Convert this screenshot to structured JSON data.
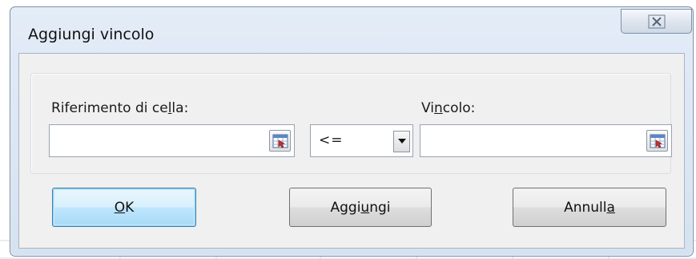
{
  "dialog": {
    "title": "Aggiungi vincolo",
    "close_glyph": "☒"
  },
  "fields": {
    "cell_reference": {
      "label_pre": "Riferimento di ce",
      "label_mnemonic": "l",
      "label_post": "la:",
      "value": "",
      "button_icon": "collapse-dialog-icon"
    },
    "operator": {
      "selected": "<=",
      "arrow_icon": "dropdown-arrow-icon"
    },
    "constraint": {
      "label_pre": "Vi",
      "label_mnemonic": "n",
      "label_post": "colo:",
      "value": "",
      "button_icon": "collapse-dialog-icon"
    }
  },
  "buttons": {
    "ok": {
      "mnemonic": "O",
      "rest": "K"
    },
    "add": {
      "pre": "Aggi",
      "mnemonic": "u",
      "post": "ngi"
    },
    "cancel": {
      "pre": "Annull",
      "mnemonic": "a",
      "post": ""
    }
  },
  "colors": {
    "default_button_border": "#3c7fb1",
    "frame": "#d5e2f0"
  }
}
